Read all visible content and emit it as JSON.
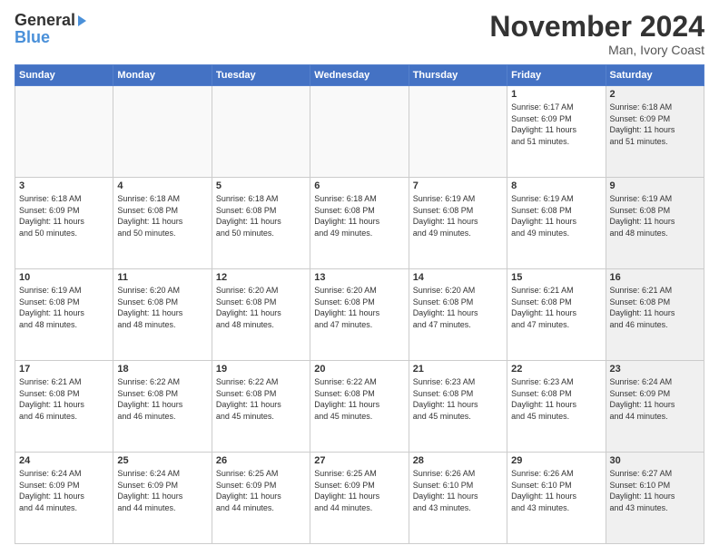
{
  "header": {
    "logo_general": "General",
    "logo_blue": "Blue",
    "month_title": "November 2024",
    "location": "Man, Ivory Coast"
  },
  "days_of_week": [
    "Sunday",
    "Monday",
    "Tuesday",
    "Wednesday",
    "Thursday",
    "Friday",
    "Saturday"
  ],
  "weeks": [
    [
      {
        "day": "",
        "info": "",
        "empty": true
      },
      {
        "day": "",
        "info": "",
        "empty": true
      },
      {
        "day": "",
        "info": "",
        "empty": true
      },
      {
        "day": "",
        "info": "",
        "empty": true
      },
      {
        "day": "",
        "info": "",
        "empty": true
      },
      {
        "day": "1",
        "info": "Sunrise: 6:17 AM\nSunset: 6:09 PM\nDaylight: 11 hours\nand 51 minutes.",
        "shaded": false
      },
      {
        "day": "2",
        "info": "Sunrise: 6:18 AM\nSunset: 6:09 PM\nDaylight: 11 hours\nand 51 minutes.",
        "shaded": true
      }
    ],
    [
      {
        "day": "3",
        "info": "Sunrise: 6:18 AM\nSunset: 6:09 PM\nDaylight: 11 hours\nand 50 minutes.",
        "shaded": false
      },
      {
        "day": "4",
        "info": "Sunrise: 6:18 AM\nSunset: 6:08 PM\nDaylight: 11 hours\nand 50 minutes.",
        "shaded": false
      },
      {
        "day": "5",
        "info": "Sunrise: 6:18 AM\nSunset: 6:08 PM\nDaylight: 11 hours\nand 50 minutes.",
        "shaded": false
      },
      {
        "day": "6",
        "info": "Sunrise: 6:18 AM\nSunset: 6:08 PM\nDaylight: 11 hours\nand 49 minutes.",
        "shaded": false
      },
      {
        "day": "7",
        "info": "Sunrise: 6:19 AM\nSunset: 6:08 PM\nDaylight: 11 hours\nand 49 minutes.",
        "shaded": false
      },
      {
        "day": "8",
        "info": "Sunrise: 6:19 AM\nSunset: 6:08 PM\nDaylight: 11 hours\nand 49 minutes.",
        "shaded": false
      },
      {
        "day": "9",
        "info": "Sunrise: 6:19 AM\nSunset: 6:08 PM\nDaylight: 11 hours\nand 48 minutes.",
        "shaded": true
      }
    ],
    [
      {
        "day": "10",
        "info": "Sunrise: 6:19 AM\nSunset: 6:08 PM\nDaylight: 11 hours\nand 48 minutes.",
        "shaded": false
      },
      {
        "day": "11",
        "info": "Sunrise: 6:20 AM\nSunset: 6:08 PM\nDaylight: 11 hours\nand 48 minutes.",
        "shaded": false
      },
      {
        "day": "12",
        "info": "Sunrise: 6:20 AM\nSunset: 6:08 PM\nDaylight: 11 hours\nand 48 minutes.",
        "shaded": false
      },
      {
        "day": "13",
        "info": "Sunrise: 6:20 AM\nSunset: 6:08 PM\nDaylight: 11 hours\nand 47 minutes.",
        "shaded": false
      },
      {
        "day": "14",
        "info": "Sunrise: 6:20 AM\nSunset: 6:08 PM\nDaylight: 11 hours\nand 47 minutes.",
        "shaded": false
      },
      {
        "day": "15",
        "info": "Sunrise: 6:21 AM\nSunset: 6:08 PM\nDaylight: 11 hours\nand 47 minutes.",
        "shaded": false
      },
      {
        "day": "16",
        "info": "Sunrise: 6:21 AM\nSunset: 6:08 PM\nDaylight: 11 hours\nand 46 minutes.",
        "shaded": true
      }
    ],
    [
      {
        "day": "17",
        "info": "Sunrise: 6:21 AM\nSunset: 6:08 PM\nDaylight: 11 hours\nand 46 minutes.",
        "shaded": false
      },
      {
        "day": "18",
        "info": "Sunrise: 6:22 AM\nSunset: 6:08 PM\nDaylight: 11 hours\nand 46 minutes.",
        "shaded": false
      },
      {
        "day": "19",
        "info": "Sunrise: 6:22 AM\nSunset: 6:08 PM\nDaylight: 11 hours\nand 45 minutes.",
        "shaded": false
      },
      {
        "day": "20",
        "info": "Sunrise: 6:22 AM\nSunset: 6:08 PM\nDaylight: 11 hours\nand 45 minutes.",
        "shaded": false
      },
      {
        "day": "21",
        "info": "Sunrise: 6:23 AM\nSunset: 6:08 PM\nDaylight: 11 hours\nand 45 minutes.",
        "shaded": false
      },
      {
        "day": "22",
        "info": "Sunrise: 6:23 AM\nSunset: 6:08 PM\nDaylight: 11 hours\nand 45 minutes.",
        "shaded": false
      },
      {
        "day": "23",
        "info": "Sunrise: 6:24 AM\nSunset: 6:09 PM\nDaylight: 11 hours\nand 44 minutes.",
        "shaded": true
      }
    ],
    [
      {
        "day": "24",
        "info": "Sunrise: 6:24 AM\nSunset: 6:09 PM\nDaylight: 11 hours\nand 44 minutes.",
        "shaded": false
      },
      {
        "day": "25",
        "info": "Sunrise: 6:24 AM\nSunset: 6:09 PM\nDaylight: 11 hours\nand 44 minutes.",
        "shaded": false
      },
      {
        "day": "26",
        "info": "Sunrise: 6:25 AM\nSunset: 6:09 PM\nDaylight: 11 hours\nand 44 minutes.",
        "shaded": false
      },
      {
        "day": "27",
        "info": "Sunrise: 6:25 AM\nSunset: 6:09 PM\nDaylight: 11 hours\nand 44 minutes.",
        "shaded": false
      },
      {
        "day": "28",
        "info": "Sunrise: 6:26 AM\nSunset: 6:10 PM\nDaylight: 11 hours\nand 43 minutes.",
        "shaded": false
      },
      {
        "day": "29",
        "info": "Sunrise: 6:26 AM\nSunset: 6:10 PM\nDaylight: 11 hours\nand 43 minutes.",
        "shaded": false
      },
      {
        "day": "30",
        "info": "Sunrise: 6:27 AM\nSunset: 6:10 PM\nDaylight: 11 hours\nand 43 minutes.",
        "shaded": true
      }
    ]
  ]
}
